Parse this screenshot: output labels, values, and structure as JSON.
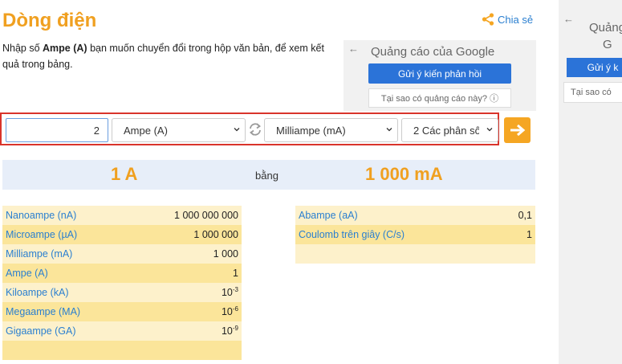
{
  "page": {
    "title": "Dòng điện",
    "share_label": "Chia sẻ",
    "intro_prefix": "Nhập số ",
    "intro_bold": "Ampe (A)",
    "intro_suffix": " bạn muốn chuyển đổi trong hộp văn bản, để xem kết quả trong bảng."
  },
  "ad": {
    "title": "Quảng cáo của Google",
    "feedback_button": "Gửi ý kiến phản hồi",
    "why_label": "Tại sao có quảng cáo này? ⓘ",
    "back_icon": "←"
  },
  "right_ad": {
    "title_line1": "Quảng",
    "title_line2": "G",
    "button": "Gửi ý k",
    "why": "Tại sao có"
  },
  "converter": {
    "value": "2",
    "from_unit": "Ampe (A)",
    "to_unit": "Milliampe (mA)",
    "decimals": "2 Các phân số",
    "accent": "#f5a623"
  },
  "result": {
    "from": "1 A",
    "equals": "bằng",
    "to": "1 000 mA"
  },
  "table_left": [
    {
      "name": "Nanoampe (nA)",
      "value": "1 000 000 000",
      "exp": ""
    },
    {
      "name": "Microampe (µA)",
      "value": "1 000 000",
      "exp": ""
    },
    {
      "name": "Milliampe (mA)",
      "value": "1 000",
      "exp": ""
    },
    {
      "name": "Ampe (A)",
      "value": "1",
      "exp": ""
    },
    {
      "name": "Kiloampe (kA)",
      "value": "10",
      "exp": "-3"
    },
    {
      "name": "Megaampe (MA)",
      "value": "10",
      "exp": "-6"
    },
    {
      "name": "Gigaampe (GA)",
      "value": "10",
      "exp": "-9"
    },
    {
      "name": "",
      "value": "",
      "exp": ""
    }
  ],
  "table_right": [
    {
      "name": "Abampe (aA)",
      "value": "0,1",
      "exp": ""
    },
    {
      "name": "Coulomb trên giây (C/s)",
      "value": "1",
      "exp": ""
    },
    {
      "name": "",
      "value": "",
      "exp": ""
    }
  ]
}
